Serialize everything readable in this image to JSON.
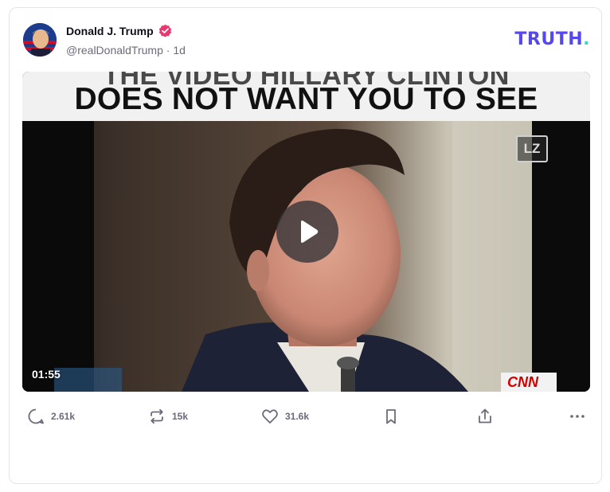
{
  "post": {
    "author": {
      "display_name": "Donald J. Trump",
      "handle": "@realDonaldTrump",
      "separator": "·",
      "age": "1d",
      "verified": true
    },
    "brand": {
      "logo_text": "TRUTH",
      "logo_dot": ".",
      "color": "#5448ee",
      "dot_color": "#3cd6c4"
    },
    "video": {
      "caption_top": "THE VIDEO HILLARY CLINTON",
      "caption_main": "DOES NOT WANT YOU TO SEE",
      "channel_bug": "LZ",
      "network_bug": "CNN",
      "duration": "01:55",
      "play_icon": "play-icon"
    },
    "actions": {
      "replies": {
        "icon": "reply-icon",
        "count": "2.61k"
      },
      "retruths": {
        "icon": "repost-icon",
        "count": "15k"
      },
      "likes": {
        "icon": "heart-icon",
        "count": "31.6k"
      },
      "bookmark": {
        "icon": "bookmark-icon"
      },
      "share": {
        "icon": "share-icon"
      },
      "more": {
        "icon": "more-icon"
      }
    }
  }
}
